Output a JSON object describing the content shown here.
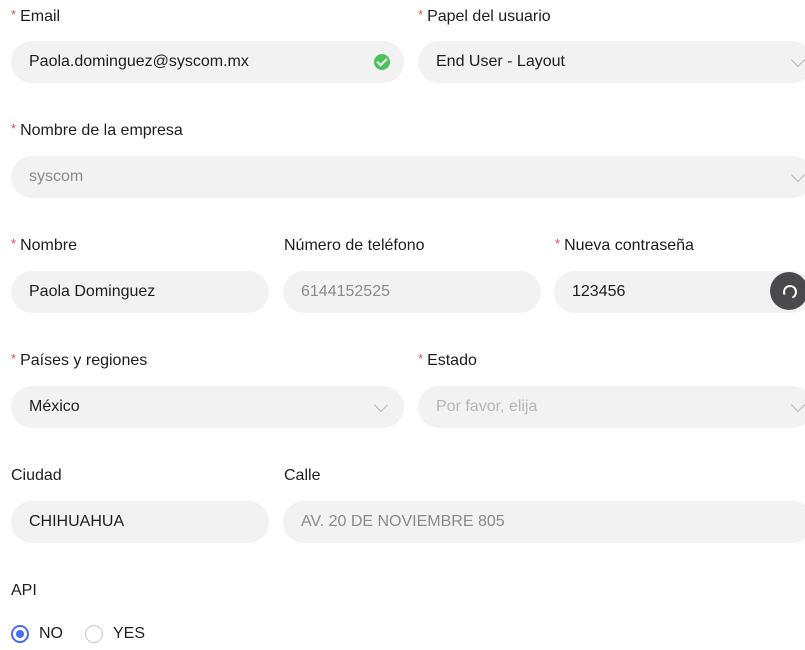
{
  "email": {
    "label": "Email",
    "value": "Paola.dominguez@syscom.mx",
    "status_icon": "check-circle-icon",
    "status_color": "#4bc25a"
  },
  "role": {
    "label": "Papel del usuario",
    "value": "End User - Layout"
  },
  "company": {
    "label": "Nombre de la empresa",
    "value": "syscom"
  },
  "name": {
    "label": "Nombre",
    "value": "Paola Dominguez"
  },
  "phone": {
    "label": "Número de teléfono",
    "value": "6144152525"
  },
  "password": {
    "label": "Nueva contraseña",
    "value": "123456"
  },
  "country": {
    "label": "Países y regiones",
    "value": "México"
  },
  "state": {
    "label": "Estado",
    "placeholder": "Por favor, elija"
  },
  "city": {
    "label": "Ciudad",
    "value": "CHIHUAHUA"
  },
  "street": {
    "label": "Calle",
    "value": "AV. 20 DE NOVIEMBRE 805"
  },
  "api": {
    "label": "API",
    "options": [
      {
        "label": "NO",
        "selected": true
      },
      {
        "label": "YES",
        "selected": false
      }
    ]
  },
  "colors": {
    "accent": "#4a6cf7",
    "required": "#e5484d",
    "field_bg": "#f2f2f2"
  }
}
